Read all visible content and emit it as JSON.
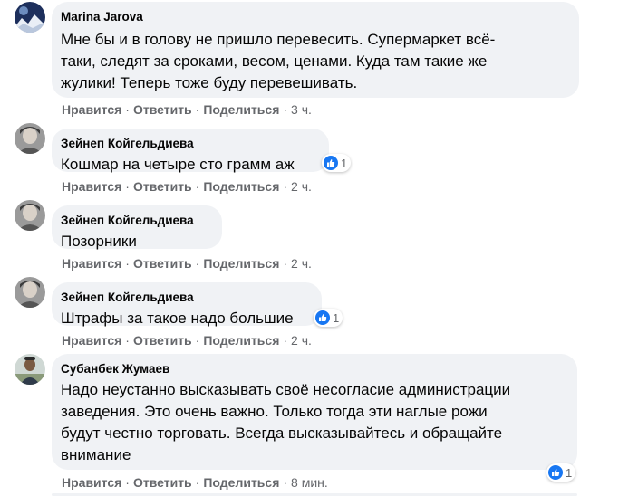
{
  "actions": {
    "like": "Нравится",
    "reply": "Ответить",
    "share": "Поделиться",
    "separator": "·"
  },
  "comments": [
    {
      "author": "Marina Jarova",
      "text": "Мне бы и в голову не пришло перевесить. Супермаркет всё-\nтаки, следят за сроками, весом, ценами. Куда там такие же\nжулики! Теперь тоже буду перевешивать.",
      "time": "3 ч.",
      "reactions": null
    },
    {
      "author": "Зейнеп Койгельдиева",
      "text": "Кошмар на четыре сто грамм аж",
      "time": "2 ч.",
      "reactions": "1"
    },
    {
      "author": "Зейнеп Койгельдиева",
      "text": "Позорники",
      "time": "2 ч.",
      "reactions": null
    },
    {
      "author": "Зейнеп Койгельдиева",
      "text": "Штрафы за такое надо большие",
      "time": "2 ч.",
      "reactions": "1"
    },
    {
      "author": "Субанбек Жумаев",
      "text": "Надо неустанно высказывать своё несогласие администрации\nзаведения. Это очень важно. Только тогда эти наглые рожи\nбудут честно торговать. Всегда высказывайтесь и обращайте\nвнимание",
      "time": "8 мин.",
      "reactions": "1"
    }
  ],
  "colors": {
    "bubble": "#f0f2f5",
    "meta": "#65676b",
    "like_blue": "#1877f2"
  },
  "icons": {
    "like": "thumbs-up-icon"
  }
}
